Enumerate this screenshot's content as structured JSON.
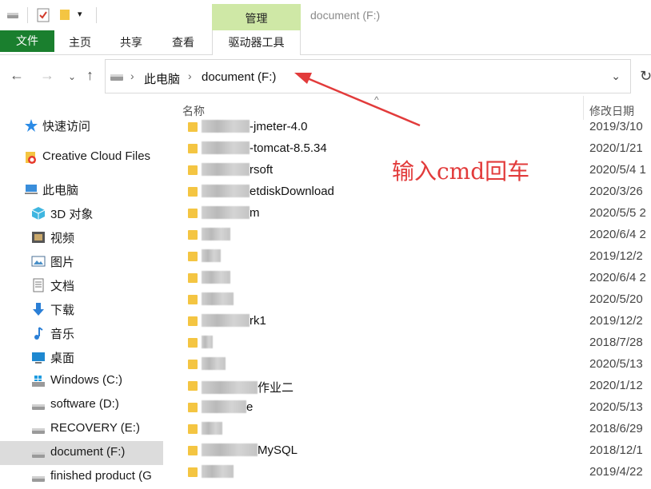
{
  "window": {
    "title": "document (F:)",
    "manage_tab": "管理"
  },
  "ribbon": {
    "file": "文件",
    "home": "主页",
    "share": "共享",
    "view": "查看",
    "drive_tools": "驱动器工具"
  },
  "address": {
    "root": "此电脑",
    "current": "document (F:)"
  },
  "sidebar": {
    "items": [
      {
        "label": "快速访问",
        "icon": "star-icon"
      },
      {
        "label": "Creative Cloud Files",
        "icon": "creative-cloud-icon"
      },
      {
        "label": "此电脑",
        "icon": "computer-icon"
      },
      {
        "label": "3D 对象",
        "icon": "3d-objects-icon"
      },
      {
        "label": "视频",
        "icon": "video-icon"
      },
      {
        "label": "图片",
        "icon": "pictures-icon"
      },
      {
        "label": "文档",
        "icon": "documents-icon"
      },
      {
        "label": "下载",
        "icon": "download-icon"
      },
      {
        "label": "音乐",
        "icon": "music-icon"
      },
      {
        "label": "桌面",
        "icon": "desktop-icon"
      },
      {
        "label": "Windows (C:)",
        "icon": "windows-drive-icon"
      },
      {
        "label": "software (D:)",
        "icon": "drive-icon"
      },
      {
        "label": "RECOVERY (E:)",
        "icon": "drive-icon"
      },
      {
        "label": "document (F:)",
        "icon": "drive-icon",
        "selected": true
      },
      {
        "label": "finished product (G",
        "icon": "drive-icon"
      }
    ]
  },
  "columns": {
    "name": "名称",
    "modified": "修改日期"
  },
  "files": [
    {
      "name": "-jmeter-4.0",
      "date": "2019/3/10"
    },
    {
      "name": "-tomcat-8.5.34",
      "date": "2020/1/21"
    },
    {
      "name": "rsoft",
      "date": "2020/5/4 1"
    },
    {
      "name": "etdiskDownload",
      "date": "2020/3/26"
    },
    {
      "name": "m",
      "date": "2020/5/5 2"
    },
    {
      "name": "",
      "date": "2020/6/4 2"
    },
    {
      "name": "",
      "date": "2019/12/2"
    },
    {
      "name": "",
      "date": "2020/6/4 2"
    },
    {
      "name": "",
      "date": "2020/5/20"
    },
    {
      "name": "rk1",
      "date": "2019/12/2"
    },
    {
      "name": "",
      "date": "2018/7/28"
    },
    {
      "name": "",
      "date": "2020/5/13"
    },
    {
      "name": "作业二",
      "date": "2020/1/12"
    },
    {
      "name": "e",
      "date": "2020/5/13"
    },
    {
      "name": "",
      "date": "2018/6/29"
    },
    {
      "name": "MySQL",
      "date": "2018/12/1"
    },
    {
      "name": "",
      "date": "2019/4/22"
    }
  ],
  "annotation": {
    "text": "输入cmd回车",
    "color": "#e23b3b"
  },
  "colors": {
    "file_tab": "#1a7f2e",
    "manage_tab": "#cfe8a6",
    "selected_item": "#dcdcdc",
    "folder": "#f4c542"
  }
}
